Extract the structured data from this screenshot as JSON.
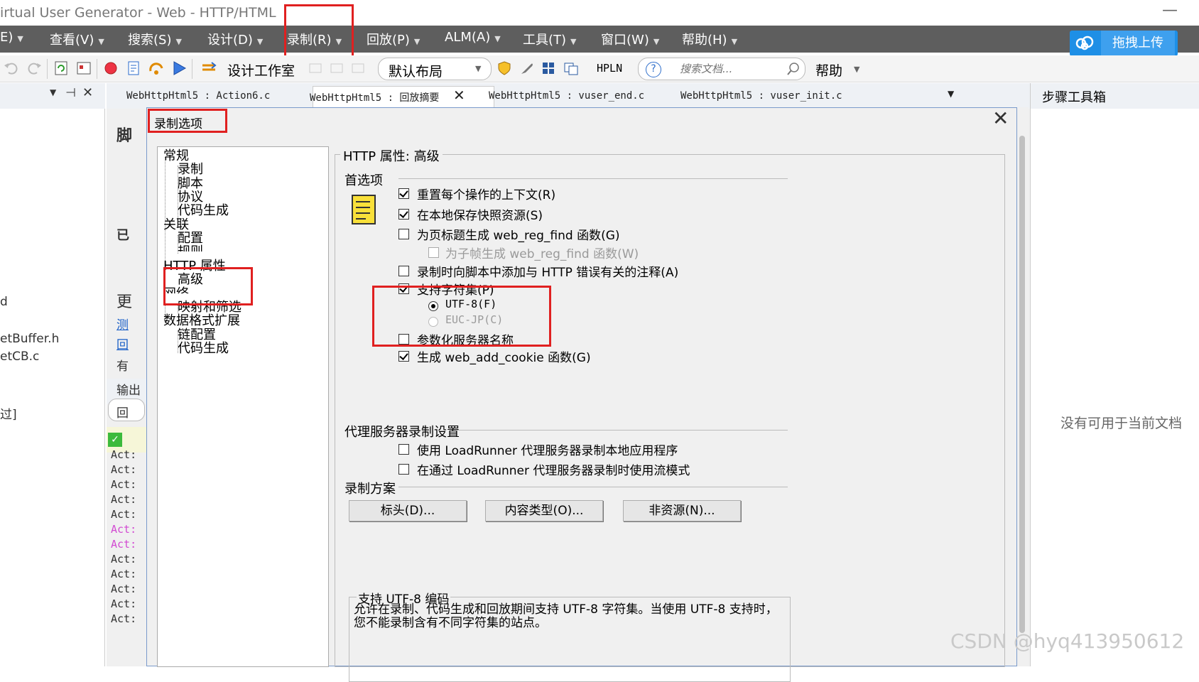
{
  "window": {
    "title": "irtual User Generator - Web - HTTP/HTML",
    "minimize": "—"
  },
  "menubar": {
    "items": [
      "E)",
      "查看(V)",
      "搜索(S)",
      "设计(D)",
      "录制(R)",
      "回放(P)",
      "ALM(A)",
      "工具(T)",
      "窗口(W)",
      "帮助(H)"
    ]
  },
  "upload": {
    "label": "拖拽上传"
  },
  "toolbar": {
    "design_studio": "设计工作室",
    "layout": "默认布局",
    "hpln": "HPLN",
    "search_placeholder": "搜索文档...",
    "help": "帮助"
  },
  "tabs": [
    "WebHttpHtml5 : Action6.c",
    "WebHttpHtml5 : 回放摘要",
    "WebHttpHtml5 : vuser_end.c",
    "WebHttpHtml5 : vuser_init.c"
  ],
  "left_panel": {
    "fragments": [
      "脚",
      "已",
      "更",
      "测",
      "回",
      "有",
      "d",
      "etBuffer.h",
      "etCB.c",
      "过]",
      "输出",
      "回",
      "Act:",
      "Act:",
      "Act:",
      "Act:",
      "Act:",
      "Act:",
      "Act:",
      "Act:",
      "Act:",
      "Act:",
      "Act:",
      "Act:"
    ]
  },
  "right_panel": {
    "title": "步骤工具箱",
    "empty_text": "没有可用于当前文档"
  },
  "dialog": {
    "title": "录制选项",
    "tree": {
      "general": "常规",
      "record": "录制",
      "script": "脚本",
      "protocol": "协议",
      "codegen": "代码生成",
      "correlation": "关联",
      "config": "配置",
      "rules": "规则",
      "http_props": "HTTP 属性",
      "advanced": "高级",
      "network": "网络",
      "mapping": "映射和筛选",
      "data_ext": "数据格式扩展",
      "chain_config": "链配置",
      "codegen2": "代码生成"
    },
    "group_title": "HTTP 属性: 高级",
    "prefs_title": "首选项",
    "options": {
      "reset_context": "重置每个操作的上下文(R)",
      "save_snapshot": "在本地保存快照资源(S)",
      "gen_find": "为页标题生成 web_reg_find 函数(G)",
      "gen_find_sub": "为子帧生成 web_reg_find 函数(W)",
      "add_comments": "录制时向脚本中添加与 HTTP 错误有关的注释(A)",
      "charset": "支持字符集(P)",
      "utf8": "UTF-8(F)",
      "eucjp": "EUC-JP(C)",
      "param_server": "参数化服务器名称",
      "gen_cookie": "生成 web_add_cookie 函数(G)"
    },
    "proxy_title": "代理服务器录制设置",
    "proxy": {
      "use_proxy": "使用 LoadRunner 代理服务器录制本地应用程序",
      "stream": "在通过 LoadRunner 代理服务器录制时使用流模式"
    },
    "scheme_title": "录制方案",
    "buttons": {
      "headers": "标头(D)...",
      "content_types": "内容类型(O)...",
      "non_resources": "非资源(N)..."
    },
    "desc_title": "支持 UTF-8 编码",
    "desc_text": "允许在录制、代码生成和回放期间支持 UTF-8 字符集。当使用 UTF-8 支持时，您不能录制含有不同字符集的站点。",
    "close": "✕"
  },
  "watermark": "CSDN @hyq413950612",
  "colors": {
    "menubar": "#5e5e5e",
    "highlight": "#e02020",
    "upload": "#1e8fe6"
  }
}
